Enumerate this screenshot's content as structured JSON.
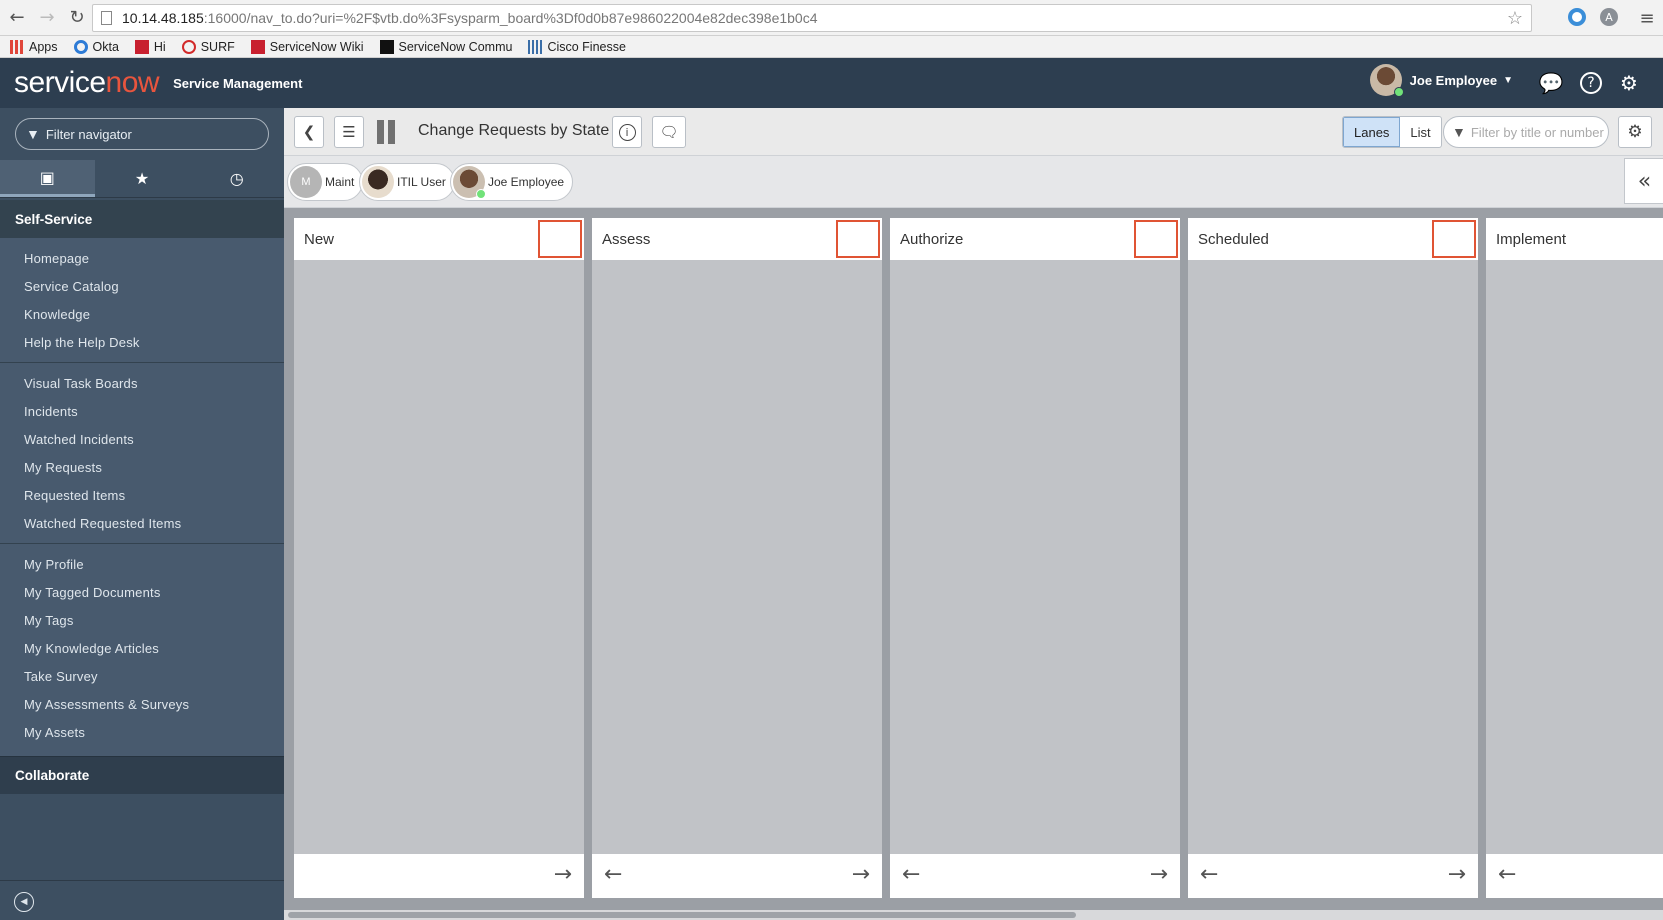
{
  "browser": {
    "url_host": "10.14.48.185",
    "url_rest": ":16000/nav_to.do?uri=%2F$vtb.do%3Fsysparm_board%3Df0d0b87e986022004e82dec398e1b0c4",
    "bookmarks": [
      {
        "label": "Apps",
        "icon": "apps-grid-icon",
        "color": "#e0463a"
      },
      {
        "label": "Okta",
        "icon": "okta-icon",
        "color": "#2d7bd6"
      },
      {
        "label": "Hi",
        "icon": "servicenow-now-icon",
        "color": "#c8202f"
      },
      {
        "label": "SURF",
        "icon": "power-icon",
        "color": "#d22a2a"
      },
      {
        "label": "ServiceNow Wiki",
        "icon": "servicenow-now-icon",
        "color": "#c8202f"
      },
      {
        "label": "ServiceNow Commu",
        "icon": "servicenow-now-icon",
        "color": "#111111"
      },
      {
        "label": "Cisco Finesse",
        "icon": "cisco-icon",
        "color": "#3a6ea8"
      }
    ]
  },
  "header": {
    "logo_service": "service",
    "logo_now": "now",
    "product": "Service Management",
    "user_name": "Joe Employee",
    "colors": {
      "header_bg": "#2d3e50",
      "now_accent": "#e8553e",
      "online": "#71e279"
    }
  },
  "sidebar": {
    "filter_placeholder": "Filter navigator",
    "tabs": [
      "all-apps-icon",
      "favorites-star-icon",
      "history-clock-icon"
    ],
    "sections": [
      {
        "title": "Self-Service",
        "groups": [
          [
            "Homepage",
            "Service Catalog",
            "Knowledge",
            "Help the Help Desk"
          ],
          [
            "Visual Task Boards",
            "Incidents",
            "Watched Incidents",
            "My Requests",
            "Requested Items",
            "Watched Requested Items"
          ],
          [
            "My Profile",
            "My Tagged Documents",
            "My Tags",
            "My Knowledge Articles",
            "Take Survey",
            "My Assessments & Surveys",
            "My Assets"
          ]
        ]
      },
      {
        "title": "Collaborate"
      }
    ]
  },
  "board": {
    "title": "Change Requests by State",
    "view_lanes": "Lanes",
    "view_list": "List",
    "active_view": "Lanes",
    "filter_placeholder": "Filter by title or number",
    "members": [
      {
        "label": "Maint",
        "initial": "M"
      },
      {
        "label": "ITIL User"
      },
      {
        "label": "Joe Employee",
        "online": true
      }
    ],
    "lanes": [
      {
        "title": "New"
      },
      {
        "title": "Assess"
      },
      {
        "title": "Authorize"
      },
      {
        "title": "Scheduled"
      },
      {
        "title": "Implement"
      }
    ],
    "accent_color": "#e05434"
  }
}
